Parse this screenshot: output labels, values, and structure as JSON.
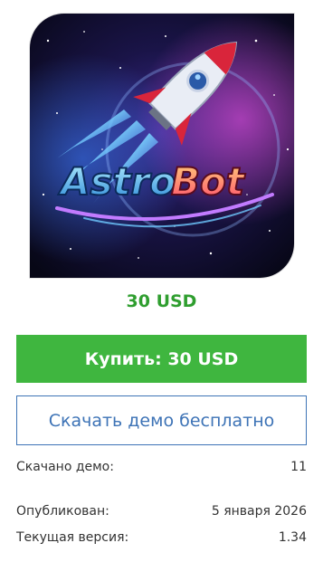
{
  "product": {
    "image_alt": "AstroBot",
    "logo_text_astro": "Astro",
    "logo_text_bot": "Bot",
    "price": "30 USD"
  },
  "actions": {
    "buy_label": "Купить: 30 USD",
    "demo_label": "Скачать демо бесплатно"
  },
  "info": {
    "downloads_label": "Скачано демо:",
    "downloads_value": "11",
    "published_label": "Опубликован:",
    "published_value": "5 января 2026",
    "version_label": "Текущая версия:",
    "version_value": "1.34"
  },
  "colors": {
    "price": "#2f9e2f",
    "buy_button": "#3fb63f",
    "demo_button": "#3d73b6"
  }
}
